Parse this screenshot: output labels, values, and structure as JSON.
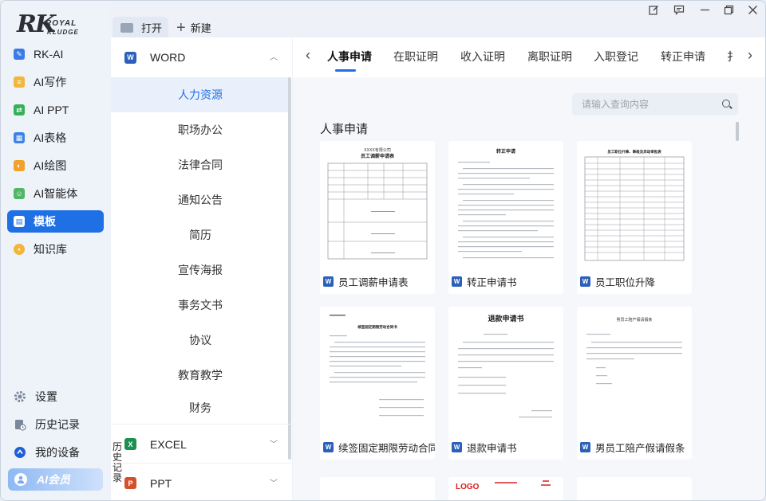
{
  "app": {
    "logo": {
      "main": "RK",
      "line1": "ROYAL",
      "line2": "KLUDGE"
    },
    "open_label": "打开",
    "new_label": "新建"
  },
  "sidebar": {
    "items": [
      {
        "label": "RK-AI",
        "icon": "rk-ai-icon",
        "color": "#3b7be8"
      },
      {
        "label": "AI写作",
        "icon": "ai-writing-icon",
        "color": "#f2b63a"
      },
      {
        "label": "AI PPT",
        "icon": "ai-ppt-icon",
        "color": "#36b15a"
      },
      {
        "label": "AI表格",
        "icon": "ai-table-icon",
        "color": "#3d82e8"
      },
      {
        "label": "AI绘图",
        "icon": "ai-drawing-icon",
        "color": "#f2a22c"
      },
      {
        "label": "AI智能体",
        "icon": "ai-agent-icon",
        "color": "#4fb765"
      },
      {
        "label": "模板",
        "icon": "template-icon",
        "color": "#1f6fe5",
        "active": true
      },
      {
        "label": "知识库",
        "icon": "knowledge-base-icon",
        "color": "#f2b63a"
      }
    ],
    "bottom": [
      {
        "label": "设置",
        "icon": "gear-icon"
      },
      {
        "label": "历史记录",
        "icon": "history-icon"
      },
      {
        "label": "我的设备",
        "icon": "device-icon"
      }
    ],
    "vip_label": "AI会员"
  },
  "categories": {
    "word": {
      "label": "WORD",
      "icon_letter": "W",
      "color": "#2b5fb8"
    },
    "excel": {
      "label": "EXCEL",
      "icon_letter": "X",
      "color": "#1d8f4e"
    },
    "ppt": {
      "label": "PPT",
      "icon_letter": "P",
      "color": "#d2512c"
    },
    "word_items": [
      "人力资源",
      "职场办公",
      "法律合同",
      "通知公告",
      "简历",
      "宣传海报",
      "事务文书",
      "协议",
      "教育教学",
      "财务"
    ],
    "active_item": "人力资源",
    "history_vertical": "历史记录"
  },
  "tabs": {
    "items": [
      "人事申请",
      "在职证明",
      "收入证明",
      "离职证明",
      "入职登记",
      "转正申请",
      "扌"
    ],
    "active": "人事申请"
  },
  "search": {
    "placeholder": "请输入查询内容"
  },
  "section_title": "人事申请",
  "cards": [
    {
      "name": "员工调薪申请表",
      "doc_title": "XXXX有限公司 员工调薪申请表"
    },
    {
      "name": "转正申请书",
      "doc_title": "转正申请"
    },
    {
      "name": "员工职位升降",
      "doc_title": "员工职位升降、降级及异动审批表"
    },
    {
      "name": "续签固定期限劳动合同...",
      "doc_title": "续签固定期限劳动合同书"
    },
    {
      "name": "退款申请书",
      "doc_title": "退款申请书"
    },
    {
      "name": "男员工陪产假请假条",
      "doc_title": "男员工陪产假请假条"
    }
  ],
  "partial_cards": [
    {
      "text": "LOGO"
    }
  ],
  "colors": {
    "accent": "#1f6fe5",
    "word_blue": "#2b5fb8"
  }
}
